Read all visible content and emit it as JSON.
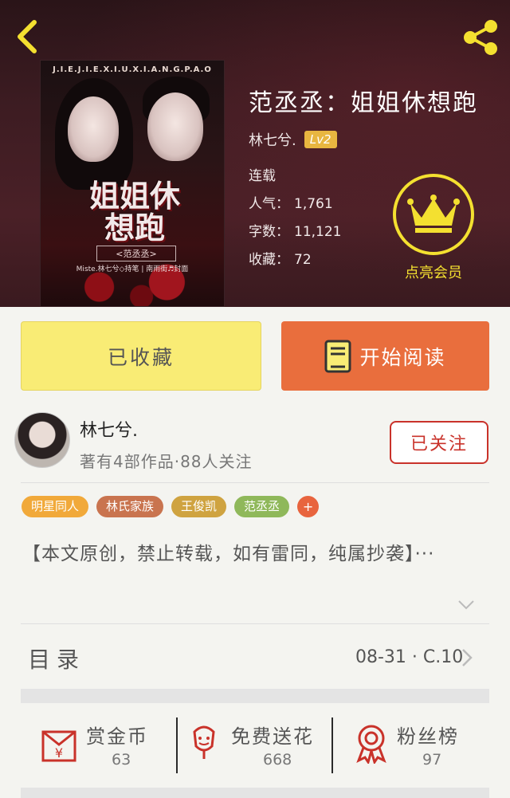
{
  "book": {
    "cover_top_text": "J.I.E.J.I.E.X.I.U.X.I.A.N.G.P.A.O",
    "cover_title": "姐姐休想跑",
    "cover_subtitle": "<范丞丞>",
    "cover_credit": "Miste.林七兮◇持笔 | 南雨街♬封面",
    "title": "范丞丞：姐姐休想跑",
    "author": "林七兮.",
    "level": "Lv2",
    "stats": [
      {
        "label": "连载",
        "value": ""
      },
      {
        "label": "人气：",
        "value": "1,761"
      },
      {
        "label": "字数：",
        "value": "11,121"
      },
      {
        "label": "收藏：",
        "value": "72"
      }
    ],
    "vip_label": "点亮会员"
  },
  "actions": {
    "collect_label": "已收藏",
    "read_label": "开始阅读"
  },
  "author_card": {
    "name": "林七兮.",
    "meta": "著有4部作品·88人关注",
    "follow_label": "已关注"
  },
  "tags": [
    {
      "label": "明星同人",
      "color": "#f1a93a"
    },
    {
      "label": "林氏家族",
      "color": "#c9744f"
    },
    {
      "label": "王俊凯",
      "color": "#cfa340"
    },
    {
      "label": "范丞丞",
      "color": "#8fb85a"
    }
  ],
  "tag_add_label": "+",
  "description": "【本文原创，禁止转载，如有雷同，纯属抄袭】···",
  "toc": {
    "label": "目录",
    "update": "08-31 · C.10"
  },
  "bottom": [
    {
      "label": "赏金币",
      "count": "63",
      "icon": "red-envelope-icon"
    },
    {
      "label": "免费送花",
      "count": "668",
      "icon": "flower-icon"
    },
    {
      "label": "粉丝榜",
      "count": "97",
      "icon": "medal-icon"
    }
  ],
  "colors": {
    "accent_orange": "#e96e3d",
    "collect_yellow": "#f9ec75",
    "vip_yellow": "#f4e030",
    "follow_red": "#c9322a"
  }
}
